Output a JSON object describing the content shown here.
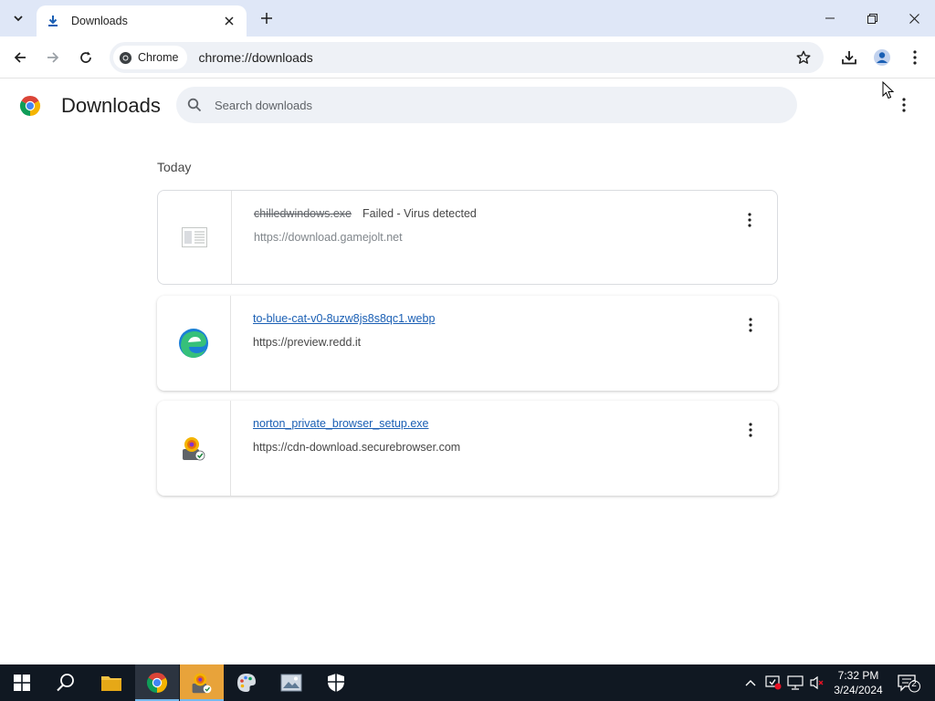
{
  "browser": {
    "tab": {
      "title": "Downloads"
    },
    "omnibox": {
      "chip_label": "Chrome",
      "url": "chrome://downloads"
    }
  },
  "page": {
    "title": "Downloads",
    "search": {
      "placeholder": "Search downloads"
    },
    "section_date": "Today"
  },
  "downloads": [
    {
      "file_name": "chilledwindows.exe",
      "status": "Failed - Virus detected",
      "source_url": "https://download.gamejolt.net",
      "icon": "blank-file-icon"
    },
    {
      "file_name": "to-blue-cat-v0-8uzw8js8s8qc1.webp",
      "status": "",
      "source_url": "https://preview.redd.it",
      "icon": "edge-file-icon"
    },
    {
      "file_name": "norton_private_browser_setup.exe",
      "status": "",
      "source_url": "https://cdn-download.securebrowser.com",
      "icon": "norton-installer-icon"
    }
  ],
  "taskbar": {
    "apps": [
      "start-button",
      "search-button",
      "file-explorer",
      "chrome",
      "norton-installer",
      "paint",
      "photo-viewer",
      "windows-security"
    ],
    "clock": {
      "time": "7:32 PM",
      "date": "3/24/2024"
    },
    "notification_count": "2"
  },
  "colors": {
    "tabstrip": "#dfe7f7",
    "link": "#1a5fb4",
    "taskbar": "#101822"
  }
}
